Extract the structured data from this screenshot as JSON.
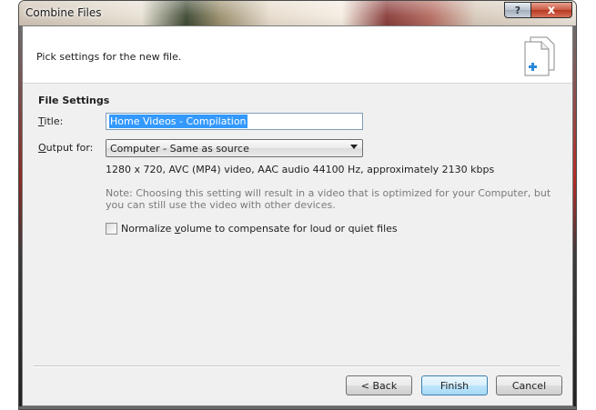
{
  "window": {
    "title": "Combine Files",
    "help_glyph": "?",
    "close_glyph": "x"
  },
  "header": {
    "subtitle": "Pick settings for the new file."
  },
  "settings": {
    "section_title": "File Settings",
    "title_label_access": "T",
    "title_label_rest": "itle:",
    "title_value": "Home Videos - Compilation",
    "output_label_access": "O",
    "output_label_rest": "utput for:",
    "output_selected": "Computer - Same as source",
    "info_text": "1280 x 720, AVC (MP4) video, AAC audio 44100 Hz, approximately 2130 kbps",
    "note_text": "Note: Choosing this setting will result in a video that is optimized for your Computer, but you can still use the video with other devices.",
    "normalize_pre": "Normalize ",
    "normalize_access": "v",
    "normalize_post": "olume to compensate for loud or quiet files",
    "normalize_checked": false
  },
  "buttons": {
    "back": "< Back",
    "finish": "Finish",
    "cancel": "Cancel"
  },
  "colors": {
    "selection": "#3399ff",
    "note_text": "#7a7a7a",
    "close_button": "#c85a44",
    "icon_plus": "#2a8ad8"
  },
  "icons": {
    "help": "question-icon",
    "close": "close-icon",
    "document": "document-add-icon",
    "dropdown": "chevron-down-icon"
  }
}
